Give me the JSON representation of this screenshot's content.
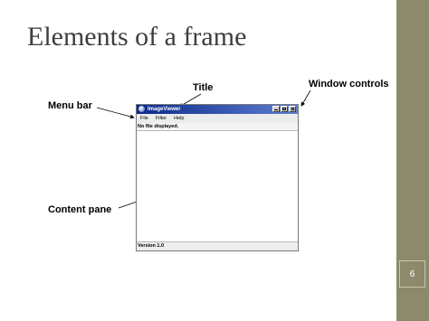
{
  "slide": {
    "title": "Elements of a frame",
    "page_number": "6"
  },
  "callouts": {
    "title": "Title",
    "window_controls": "Window controls",
    "menu_bar": "Menu bar",
    "content_pane": "Content pane"
  },
  "window": {
    "title": "ImageViewer",
    "menus": [
      "File",
      "Filter",
      "Help"
    ],
    "status_top": "No file displayed.",
    "status_bottom": "Version 1.0"
  },
  "colors": {
    "accent_band": "#8c8a6a",
    "titlebar_dark": "#0b2a8a",
    "titlebar_light": "#5d7fd0"
  }
}
